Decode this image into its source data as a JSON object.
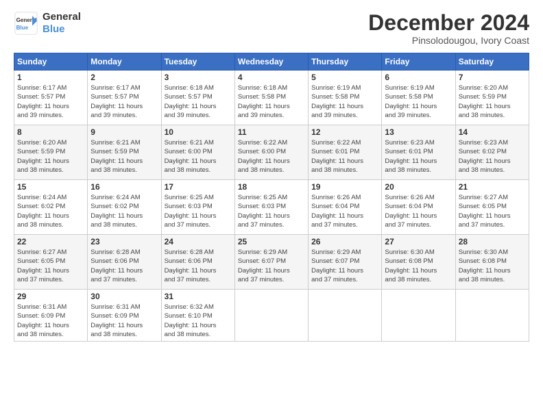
{
  "header": {
    "logo_line1": "General",
    "logo_line2": "Blue",
    "month_title": "December 2024",
    "location": "Pinsolodougou, Ivory Coast"
  },
  "days_of_week": [
    "Sunday",
    "Monday",
    "Tuesday",
    "Wednesday",
    "Thursday",
    "Friday",
    "Saturday"
  ],
  "weeks": [
    [
      {
        "day": "1",
        "info": "Sunrise: 6:17 AM\nSunset: 5:57 PM\nDaylight: 11 hours\nand 39 minutes."
      },
      {
        "day": "2",
        "info": "Sunrise: 6:17 AM\nSunset: 5:57 PM\nDaylight: 11 hours\nand 39 minutes."
      },
      {
        "day": "3",
        "info": "Sunrise: 6:18 AM\nSunset: 5:57 PM\nDaylight: 11 hours\nand 39 minutes."
      },
      {
        "day": "4",
        "info": "Sunrise: 6:18 AM\nSunset: 5:58 PM\nDaylight: 11 hours\nand 39 minutes."
      },
      {
        "day": "5",
        "info": "Sunrise: 6:19 AM\nSunset: 5:58 PM\nDaylight: 11 hours\nand 39 minutes."
      },
      {
        "day": "6",
        "info": "Sunrise: 6:19 AM\nSunset: 5:58 PM\nDaylight: 11 hours\nand 39 minutes."
      },
      {
        "day": "7",
        "info": "Sunrise: 6:20 AM\nSunset: 5:59 PM\nDaylight: 11 hours\nand 38 minutes."
      }
    ],
    [
      {
        "day": "8",
        "info": "Sunrise: 6:20 AM\nSunset: 5:59 PM\nDaylight: 11 hours\nand 38 minutes."
      },
      {
        "day": "9",
        "info": "Sunrise: 6:21 AM\nSunset: 5:59 PM\nDaylight: 11 hours\nand 38 minutes."
      },
      {
        "day": "10",
        "info": "Sunrise: 6:21 AM\nSunset: 6:00 PM\nDaylight: 11 hours\nand 38 minutes."
      },
      {
        "day": "11",
        "info": "Sunrise: 6:22 AM\nSunset: 6:00 PM\nDaylight: 11 hours\nand 38 minutes."
      },
      {
        "day": "12",
        "info": "Sunrise: 6:22 AM\nSunset: 6:01 PM\nDaylight: 11 hours\nand 38 minutes."
      },
      {
        "day": "13",
        "info": "Sunrise: 6:23 AM\nSunset: 6:01 PM\nDaylight: 11 hours\nand 38 minutes."
      },
      {
        "day": "14",
        "info": "Sunrise: 6:23 AM\nSunset: 6:02 PM\nDaylight: 11 hours\nand 38 minutes."
      }
    ],
    [
      {
        "day": "15",
        "info": "Sunrise: 6:24 AM\nSunset: 6:02 PM\nDaylight: 11 hours\nand 38 minutes."
      },
      {
        "day": "16",
        "info": "Sunrise: 6:24 AM\nSunset: 6:02 PM\nDaylight: 11 hours\nand 38 minutes."
      },
      {
        "day": "17",
        "info": "Sunrise: 6:25 AM\nSunset: 6:03 PM\nDaylight: 11 hours\nand 37 minutes."
      },
      {
        "day": "18",
        "info": "Sunrise: 6:25 AM\nSunset: 6:03 PM\nDaylight: 11 hours\nand 37 minutes."
      },
      {
        "day": "19",
        "info": "Sunrise: 6:26 AM\nSunset: 6:04 PM\nDaylight: 11 hours\nand 37 minutes."
      },
      {
        "day": "20",
        "info": "Sunrise: 6:26 AM\nSunset: 6:04 PM\nDaylight: 11 hours\nand 37 minutes."
      },
      {
        "day": "21",
        "info": "Sunrise: 6:27 AM\nSunset: 6:05 PM\nDaylight: 11 hours\nand 37 minutes."
      }
    ],
    [
      {
        "day": "22",
        "info": "Sunrise: 6:27 AM\nSunset: 6:05 PM\nDaylight: 11 hours\nand 37 minutes."
      },
      {
        "day": "23",
        "info": "Sunrise: 6:28 AM\nSunset: 6:06 PM\nDaylight: 11 hours\nand 37 minutes."
      },
      {
        "day": "24",
        "info": "Sunrise: 6:28 AM\nSunset: 6:06 PM\nDaylight: 11 hours\nand 37 minutes."
      },
      {
        "day": "25",
        "info": "Sunrise: 6:29 AM\nSunset: 6:07 PM\nDaylight: 11 hours\nand 37 minutes."
      },
      {
        "day": "26",
        "info": "Sunrise: 6:29 AM\nSunset: 6:07 PM\nDaylight: 11 hours\nand 37 minutes."
      },
      {
        "day": "27",
        "info": "Sunrise: 6:30 AM\nSunset: 6:08 PM\nDaylight: 11 hours\nand 38 minutes."
      },
      {
        "day": "28",
        "info": "Sunrise: 6:30 AM\nSunset: 6:08 PM\nDaylight: 11 hours\nand 38 minutes."
      }
    ],
    [
      {
        "day": "29",
        "info": "Sunrise: 6:31 AM\nSunset: 6:09 PM\nDaylight: 11 hours\nand 38 minutes."
      },
      {
        "day": "30",
        "info": "Sunrise: 6:31 AM\nSunset: 6:09 PM\nDaylight: 11 hours\nand 38 minutes."
      },
      {
        "day": "31",
        "info": "Sunrise: 6:32 AM\nSunset: 6:10 PM\nDaylight: 11 hours\nand 38 minutes."
      },
      {
        "day": "",
        "info": ""
      },
      {
        "day": "",
        "info": ""
      },
      {
        "day": "",
        "info": ""
      },
      {
        "day": "",
        "info": ""
      }
    ]
  ]
}
